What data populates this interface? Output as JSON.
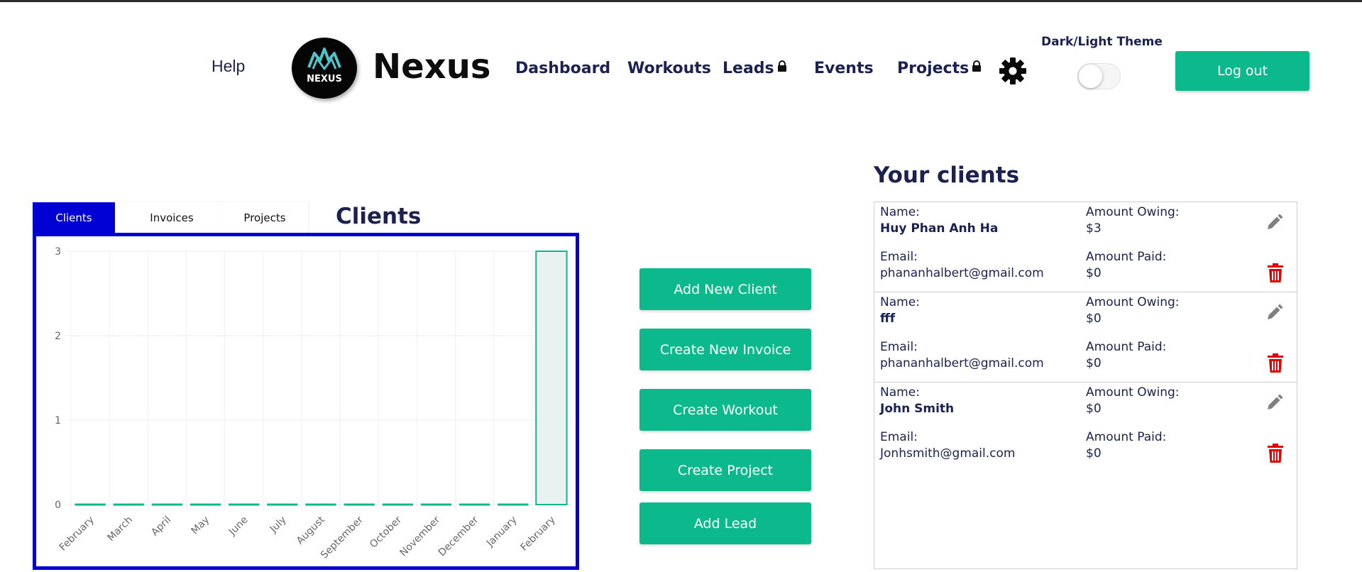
{
  "header": {
    "help_label": "Help",
    "logo_text": "NEXUS",
    "brand": "Nexus",
    "nav": [
      {
        "label": "Dashboard",
        "locked": false
      },
      {
        "label": "Workouts",
        "locked": false
      },
      {
        "label": "Leads",
        "locked": true
      },
      {
        "label": "Events",
        "locked": false
      },
      {
        "label": "Projects",
        "locked": true
      }
    ],
    "settings_icon": "gear-icon",
    "theme_label": "Dark/Light Theme",
    "theme_toggle_on": false,
    "logout_label": "Log out"
  },
  "tabs": [
    {
      "label": "Clients",
      "active": true
    },
    {
      "label": "Invoices",
      "active": false
    },
    {
      "label": "Projects",
      "active": false
    }
  ],
  "section_title": "Clients",
  "chart_data": {
    "type": "bar",
    "categories": [
      "February",
      "March",
      "April",
      "May",
      "June",
      "July",
      "August",
      "September",
      "October",
      "November",
      "December",
      "January",
      "February"
    ],
    "values": [
      0,
      0,
      0,
      0,
      0,
      0,
      0,
      0,
      0,
      0,
      0,
      0,
      3
    ],
    "ylim": [
      0,
      3
    ],
    "yticks": [
      "0",
      "1",
      "2",
      "3"
    ],
    "grid": true,
    "bar_color": "#0cb98d",
    "bar_fill": "#e9f1f1"
  },
  "actions": [
    {
      "label": "Add New Client"
    },
    {
      "label": "Create New Invoice"
    },
    {
      "label": "Create Workout"
    },
    {
      "label": "Create Project"
    },
    {
      "label": "Add Lead"
    }
  ],
  "clients_panel": {
    "title": "Your clients",
    "labels": {
      "name": "Name:",
      "email": "Email:",
      "owing": "Amount Owing:",
      "paid": "Amount Paid:"
    },
    "clients": [
      {
        "name": "Huy Phan Anh Ha",
        "email": "phananhalbert@gmail.com",
        "owing": "$3",
        "paid": "$0"
      },
      {
        "name": "fff",
        "email": "phananhalbert@gmail.com",
        "owing": "$0",
        "paid": "$0"
      },
      {
        "name": "John Smith",
        "email": "Jonhsmith@gmail.com",
        "owing": "$0",
        "paid": "$0"
      }
    ]
  },
  "colors": {
    "accent": "#0cb98d",
    "tab_active": "#0000d4",
    "text": "#1b2250",
    "delete": "#e00000",
    "edit": "#808080"
  }
}
